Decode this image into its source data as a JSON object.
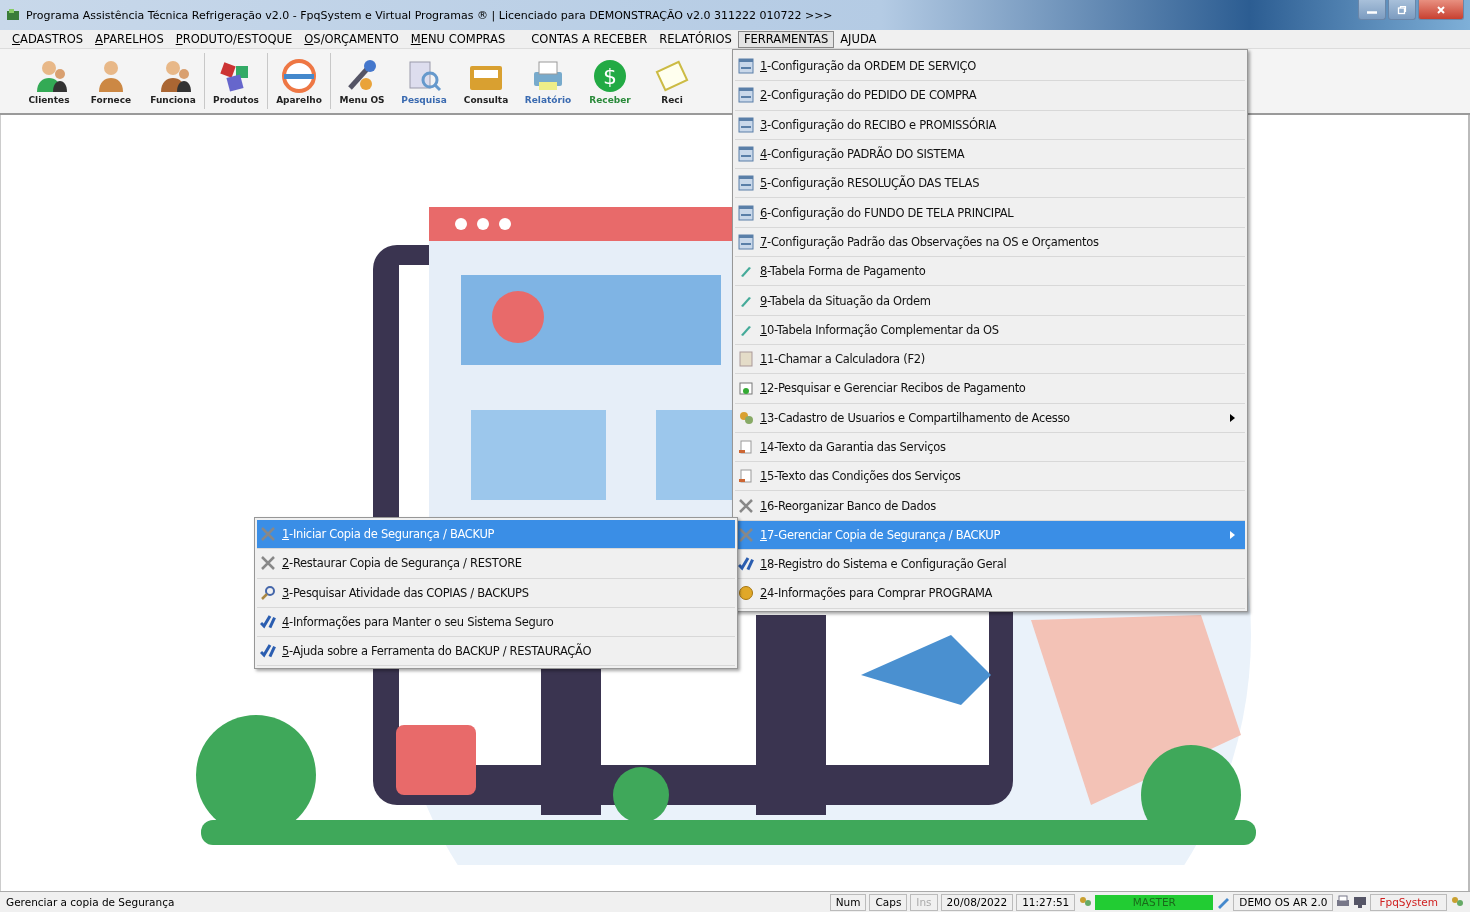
{
  "window": {
    "title": "Programa Assistência Técnica Refrigeração v2.0 - FpqSystem e Virtual Programas ® | Licenciado para  DEMONSTRAÇÃO v2.0 311222 010722 >>>"
  },
  "menu_bar": [
    {
      "label": "CADASTROS",
      "mnemonic": true,
      "selected": false
    },
    {
      "label": "APARELHOS",
      "mnemonic": true,
      "selected": false
    },
    {
      "label": "PRODUTO/ESTOQUE",
      "mnemonic": true,
      "selected": false
    },
    {
      "label": "OS/ORÇAMENTO",
      "mnemonic": true,
      "selected": false
    },
    {
      "label": "MENU COMPRAS",
      "mnemonic": true,
      "selected": false
    },
    {
      "label": "CONTAS A RECEBER",
      "mnemonic": false,
      "selected": false
    },
    {
      "label": "RELATÓRIOS",
      "mnemonic": false,
      "selected": false
    },
    {
      "label": "FERRAMENTAS",
      "mnemonic": false,
      "selected": true
    },
    {
      "label": "AJUDA",
      "mnemonic": false,
      "selected": false
    }
  ],
  "toolbar": [
    {
      "label": "Clientes",
      "kind": "people"
    },
    {
      "label": "Fornece",
      "kind": "person"
    },
    {
      "label": "Funciona",
      "kind": "couple"
    },
    {
      "label": "Produtos",
      "kind": "products"
    },
    {
      "label": "Aparelho",
      "kind": "device"
    },
    {
      "label": "Menu OS",
      "kind": "tools"
    },
    {
      "label": "Pesquisa",
      "kind": "search"
    },
    {
      "label": "Consulta",
      "kind": "folder"
    },
    {
      "label": "Relatório",
      "kind": "printer"
    },
    {
      "label": "Receber",
      "kind": "money",
      "symbol": "$"
    },
    {
      "label": "Reci",
      "kind": "receipt"
    }
  ],
  "tools_menu": [
    {
      "label": "1-Configuração da ORDEM DE SERVIÇO",
      "kind": "form",
      "selected": false,
      "has_submenu": false
    },
    {
      "label": "2-Configuração do PEDIDO DE COMPRA",
      "kind": "form",
      "selected": false,
      "has_submenu": false
    },
    {
      "label": "3-Configuração do RECIBO e PROMISSÓRIA",
      "kind": "form",
      "selected": false,
      "has_submenu": false
    },
    {
      "label": "4-Configuração PADRÃO DO SISTEMA",
      "kind": "form",
      "selected": false,
      "has_submenu": false
    },
    {
      "label": "5-Configuração RESOLUÇÃO DAS TELAS",
      "kind": "form",
      "selected": false,
      "has_submenu": false
    },
    {
      "label": "6-Configuração do FUNDO DE TELA PRINCIPAL",
      "kind": "form",
      "selected": false,
      "has_submenu": false
    },
    {
      "label": "7-Configuração Padrão das Observações na OS e Orçamentos",
      "kind": "form",
      "selected": false,
      "has_submenu": false
    },
    {
      "label": "8-Tabela Forma de Pagamento",
      "kind": "pencil",
      "selected": false,
      "has_submenu": false
    },
    {
      "label": "9-Tabela da Situação da Ordem",
      "kind": "pencil",
      "selected": false,
      "has_submenu": false
    },
    {
      "label": "10-Tabela Informação Complementar da OS",
      "kind": "pencil",
      "selected": false,
      "has_submenu": false
    },
    {
      "label": "11-Chamar a Calculadora (F2)",
      "kind": "calc",
      "selected": false,
      "has_submenu": false
    },
    {
      "label": "12-Pesquisar e Gerenciar Recibos de Pagamento",
      "kind": "receipt",
      "selected": false,
      "has_submenu": false
    },
    {
      "label": "13-Cadastro de Usuarios e Compartilhamento de Acesso",
      "kind": "users",
      "selected": false,
      "has_submenu": true
    },
    {
      "label": "14-Texto da Garantia das Serviços",
      "kind": "doc",
      "selected": false,
      "has_submenu": false
    },
    {
      "label": "15-Texto das Condições dos Serviços",
      "kind": "doc",
      "selected": false,
      "has_submenu": false
    },
    {
      "label": "16-Reorganizar Banco de Dados",
      "kind": "tools",
      "selected": false,
      "has_submenu": false
    },
    {
      "label": "17-Gerenciar Copia de Segurança / BACKUP",
      "kind": "tools",
      "selected": true,
      "has_submenu": true
    },
    {
      "label": "18-Registro do Sistema e Configuração Geral",
      "kind": "check",
      "selected": false,
      "has_submenu": false
    },
    {
      "label": "24-Informações para Comprar PROGRAMA",
      "kind": "coin",
      "selected": false,
      "has_submenu": false
    }
  ],
  "backup_submenu": [
    {
      "label": "1-Iniciar Copia de Segurança / BACKUP",
      "kind": "tools",
      "selected": true
    },
    {
      "label": "2-Restaurar Copia de Segurança / RESTORE",
      "kind": "tools",
      "selected": false
    },
    {
      "label": "3-Pesquisar Atividade das COPIAS / BACKUPS",
      "kind": "search",
      "selected": false
    },
    {
      "label": "4-Informações para Manter o seu Sistema Seguro",
      "kind": "check",
      "selected": false
    },
    {
      "label": "5-Ajuda sobre a Ferramenta do BACKUP / RESTAURAÇÃO",
      "kind": "check",
      "selected": false
    }
  ],
  "status_bar": {
    "message": "Gerenciar a copia de Segurança",
    "num": "Num",
    "caps": "Caps",
    "ins": "Ins",
    "ins_disabled": true,
    "date": "20/08/2022",
    "time": "11:27:51",
    "user": "MASTER",
    "version": "DEMO OS AR 2.0",
    "brand": "FpqSystem"
  }
}
